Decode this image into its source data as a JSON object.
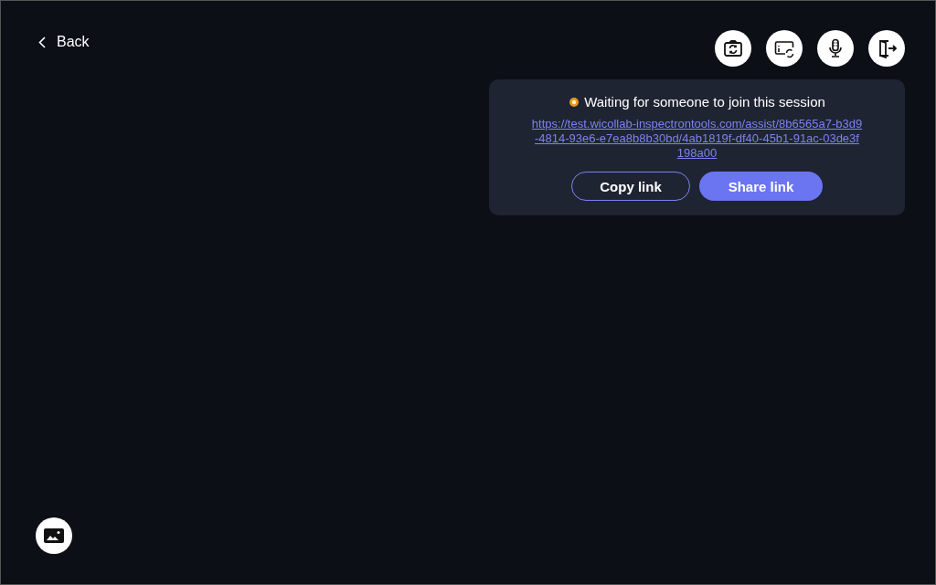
{
  "back": {
    "label": "Back"
  },
  "toolbar": [
    {
      "kind": "camera-switch"
    },
    {
      "kind": "screen-switch"
    },
    {
      "kind": "mic"
    },
    {
      "kind": "exit"
    }
  ],
  "session": {
    "status": "Waiting for someone to join this session",
    "link": "https://test.wicollab-inspectrontools.com/assist/8b6565a7-b3d9-4814-93e6-e7ea8b8b30bd/4ab1819f-df40-45b1-91ac-03de3f198a00",
    "buttons": [
      {
        "label": "Copy link",
        "kind": "outline"
      },
      {
        "label": "Share link",
        "kind": "primary"
      }
    ]
  },
  "gallery": {
    "kind": "picture-button"
  }
}
